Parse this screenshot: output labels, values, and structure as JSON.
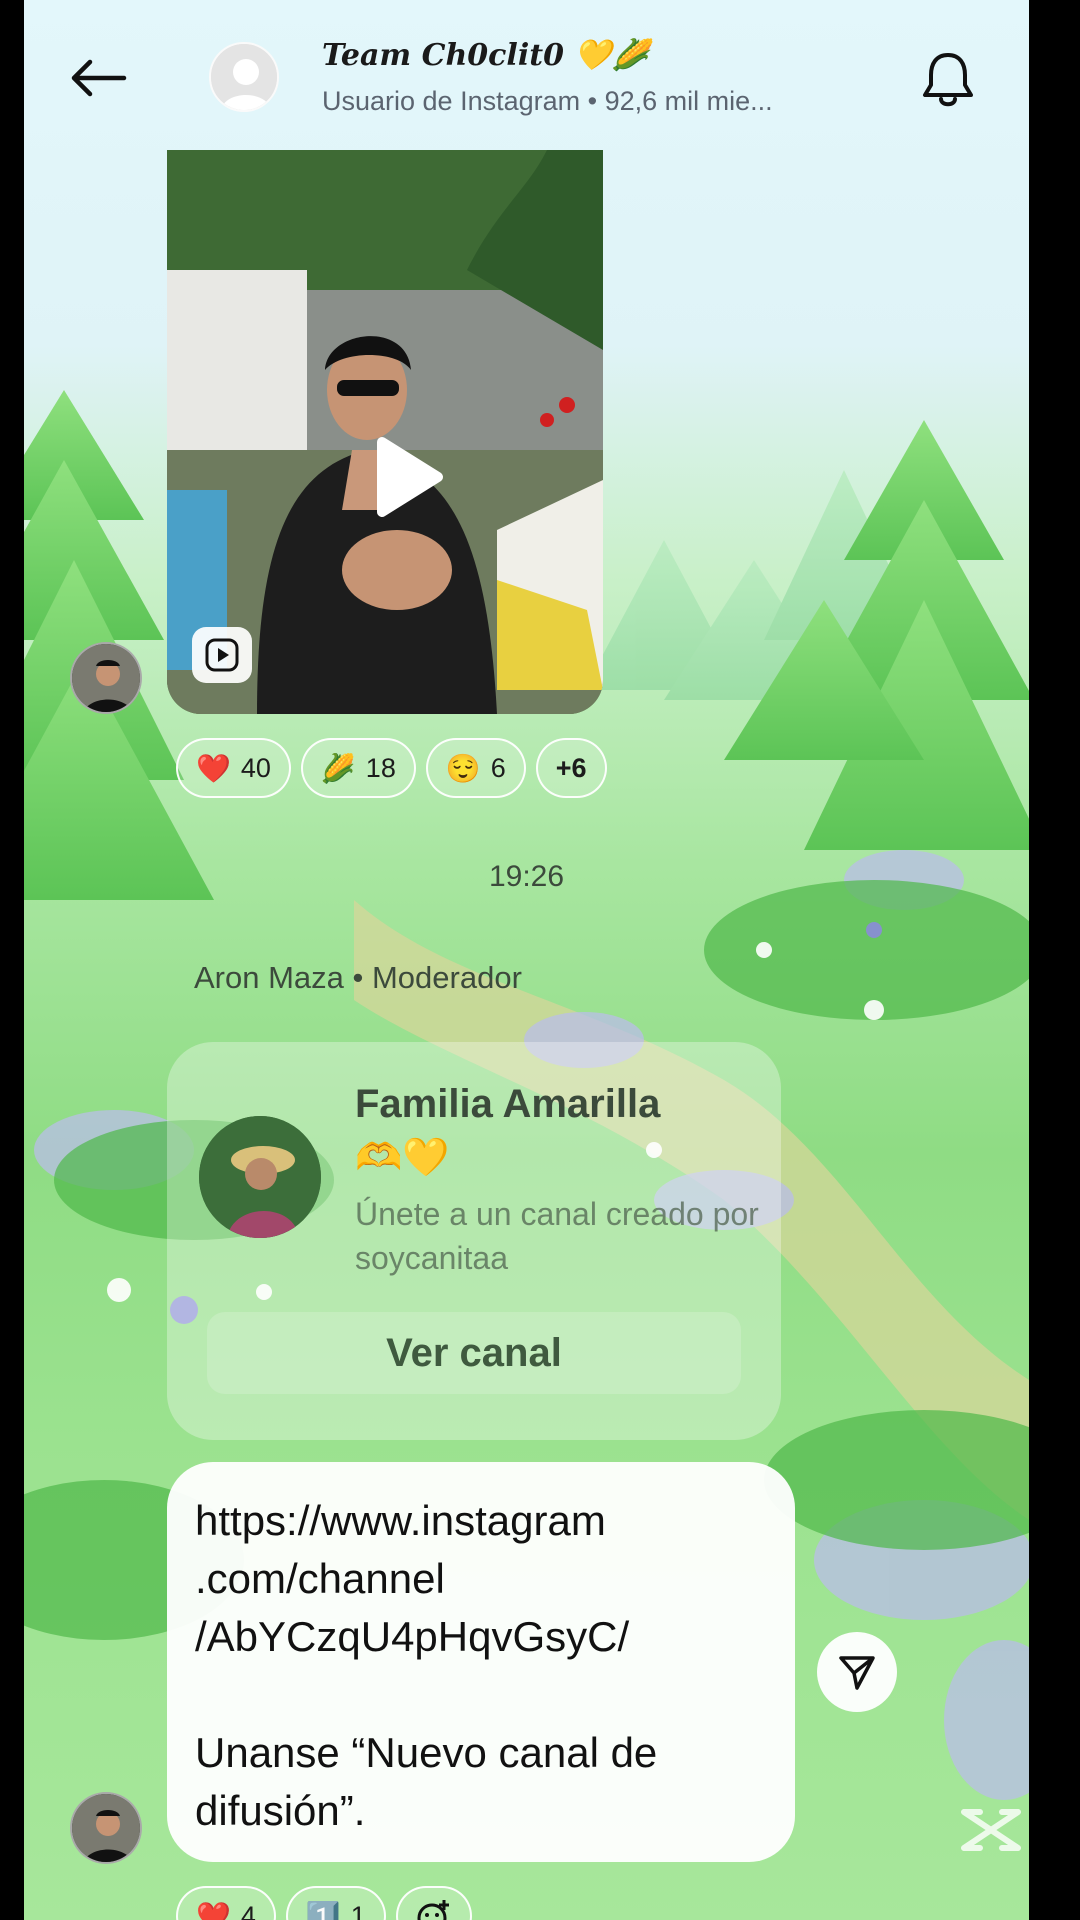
{
  "header": {
    "title": "Team Ch0clit0 💛🌽",
    "subtitle": "Usuario de Instagram • 92,6 mil mie..."
  },
  "message1": {
    "type": "reel",
    "reactions": [
      {
        "emoji": "❤️",
        "count": "40"
      },
      {
        "emoji": "🌽",
        "count": "18"
      },
      {
        "emoji": "😌",
        "count": "6"
      },
      {
        "emoji": "",
        "count": "+6"
      }
    ]
  },
  "timestamp": "19:26",
  "sender_line": "Aron Maza • Moderador",
  "channel_card": {
    "name": "Familia Amarilla",
    "emojis": "🫶💛",
    "description": "Únete a un canal creado por soycanitaa",
    "button_label": "Ver canal"
  },
  "message2": {
    "link": "https://www.instagram\n.com/channel\n/AbYCzqU4pHqvGsyC/",
    "text": "Unanse “Nuevo canal de\ndifusión”.",
    "reactions": [
      {
        "emoji": "❤️",
        "count": "4"
      },
      {
        "emoji": "1️⃣",
        "count": "1"
      },
      {
        "emoji": "",
        "count": ""
      }
    ]
  },
  "icons": {
    "back": "arrow-left-icon",
    "bell": "bell-icon",
    "play": "play-icon",
    "reel": "reel-icon",
    "share": "send-icon",
    "add_reaction": "add-reaction-icon",
    "watermark": "capcut-logo"
  }
}
